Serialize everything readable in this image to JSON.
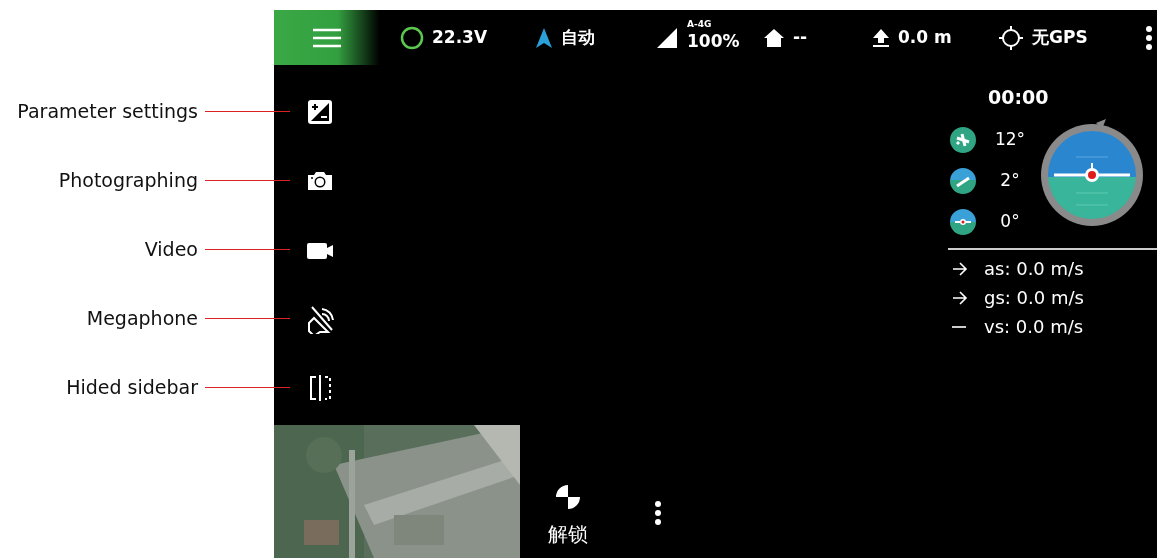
{
  "top_bar": {
    "battery": "22.3V",
    "mode": "自动",
    "network": "A-4G",
    "signal": "100%",
    "home_distance": "--",
    "altitude": "0.0 m",
    "gps": "无GPS"
  },
  "annotations": [
    {
      "label": "Parameter settings",
      "kind": "exposure"
    },
    {
      "label": "Photographing",
      "kind": "camera"
    },
    {
      "label": "Video",
      "kind": "video"
    },
    {
      "label": "Megaphone",
      "kind": "megaphone"
    },
    {
      "label": "Hided sidebar",
      "kind": "sidebar"
    }
  ],
  "timer": "00:00",
  "attitude": [
    {
      "kind": "yaw",
      "value": "12°"
    },
    {
      "kind": "pitch",
      "value": "2°"
    },
    {
      "kind": "roll",
      "value": "0°"
    }
  ],
  "speeds": [
    {
      "kind": "arrow",
      "label": "as: 0.0 m/s"
    },
    {
      "kind": "arrow",
      "label": "gs: 0.0 m/s"
    },
    {
      "kind": "dash",
      "label": "vs: 0.0 m/s"
    }
  ],
  "unlock_label": "解锁"
}
